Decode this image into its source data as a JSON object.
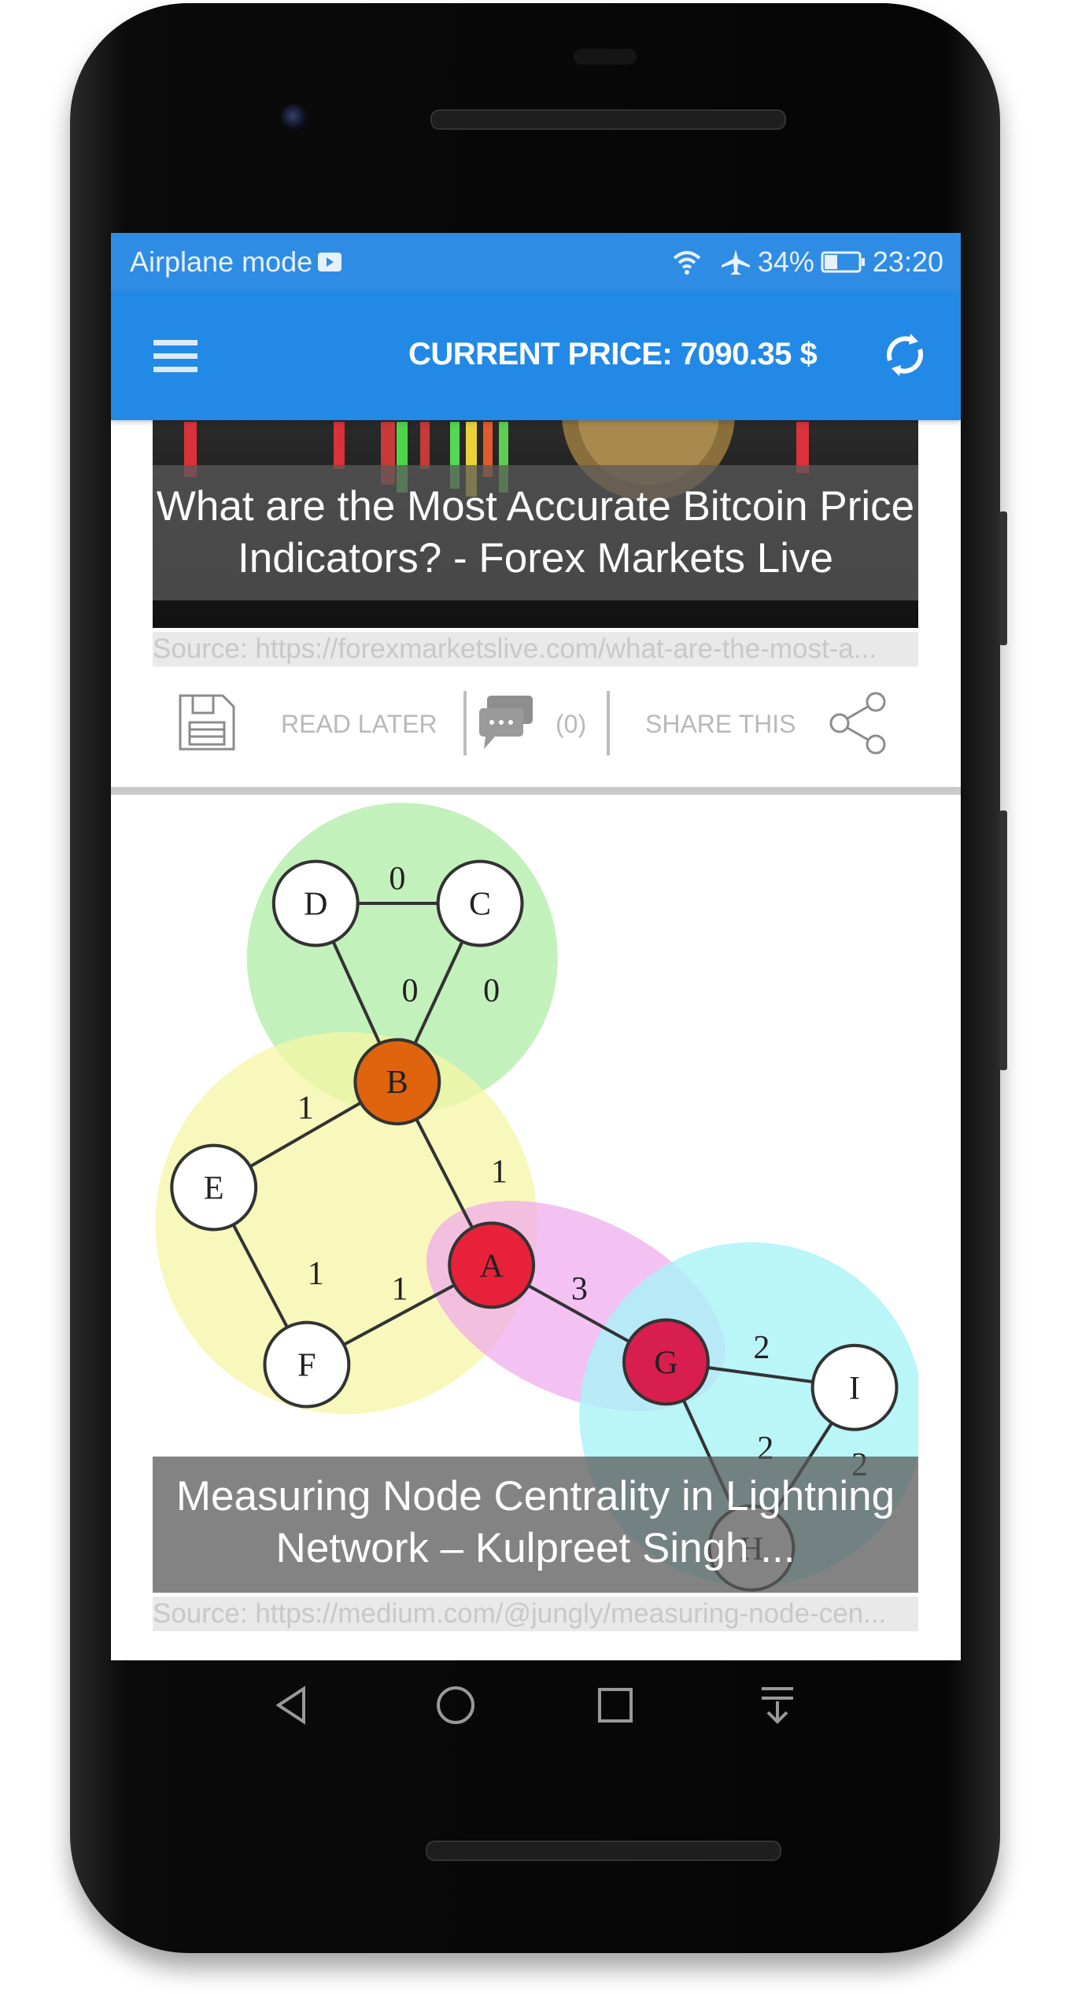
{
  "status_bar": {
    "left_text": "Airplane mode",
    "battery": "34%",
    "time": "23:20",
    "battery_level": 0.34
  },
  "app_bar": {
    "title": "CURRENT PRICE: 7090.35 $"
  },
  "articles": [
    {
      "title": "What are the Most Accurate Bitcoin Price Indicators? - Forex Markets Live",
      "source": "Source: https://forexmarketslive.com/what-are-the-most-a...",
      "read_later": "READ LATER",
      "comments": "(0)",
      "share": "SHARE THIS"
    },
    {
      "title": "Measuring Node Centrality in Lightning Network – Kulpreet Singh ...",
      "source": "Source: https://medium.com/@jungly/measuring-node-cen...",
      "graph": {
        "nodes": [
          "D",
          "C",
          "B",
          "E",
          "A",
          "F",
          "G",
          "I",
          "H"
        ],
        "edge_labels": [
          "0",
          "0",
          "0",
          "1",
          "1",
          "1",
          "1",
          "3",
          "2",
          "2",
          "2"
        ]
      }
    }
  ],
  "colors": {
    "app_bar": "#2389e6",
    "status_bar": "#2f8ce5",
    "action_text": "#b9b9b9"
  }
}
